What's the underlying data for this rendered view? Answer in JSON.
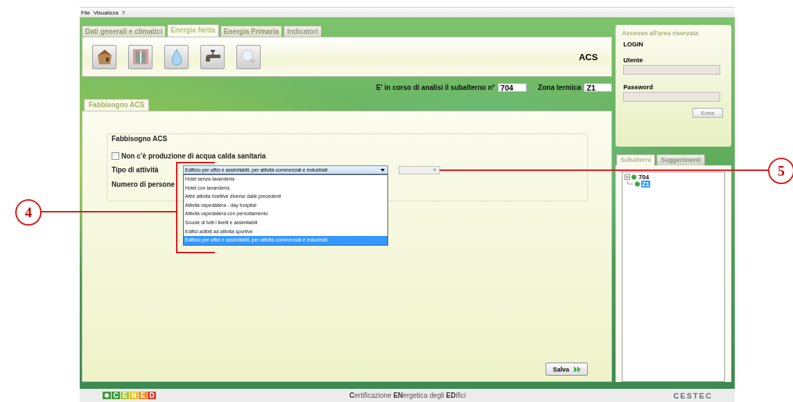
{
  "menu": [
    {
      "label": "File"
    },
    {
      "label": "Visualizza"
    },
    {
      "label": "?"
    }
  ],
  "tabs": [
    {
      "label": "Dati generali e climatici",
      "selected": false,
      "disabled": false
    },
    {
      "label": "Energia Netta",
      "selected": true,
      "disabled": false
    },
    {
      "label": "Energia Primaria",
      "selected": false,
      "disabled": false
    },
    {
      "label": "Indicatori",
      "selected": false,
      "disabled": true
    }
  ],
  "toolbar": {
    "tools": [
      {
        "kind": "building"
      },
      {
        "kind": "window"
      },
      {
        "kind": "drop"
      },
      {
        "kind": "tap"
      },
      {
        "kind": "bulb"
      }
    ],
    "section_title": "ACS"
  },
  "status": {
    "subalterno_label": "E' in corso di analisi il subalterno n°",
    "subalterno": "704",
    "zona_label": "Zona termica",
    "zona": "Z1"
  },
  "subtabs": [
    {
      "label": "Fabbisogno ACS",
      "selected": true
    }
  ],
  "group": {
    "title": "Fabbisogno ACS",
    "no_production": {
      "label": "Non c’è produzione di acqua calda sanitaria",
      "checked": false
    },
    "tipo_label": "Tipo di attività",
    "tipo_value": "Edificio per uffici e assimilabili, per attività commerciali e industriali",
    "persone_label": "Numero di persone",
    "secondary_select": {
      "disabled": true
    },
    "options": [
      {
        "label": "Hotel senza lavanderia",
        "selected": false
      },
      {
        "label": "Hotel con lavanderia",
        "selected": false
      },
      {
        "label": "Altre attività ricettive diverse dalle precedenti",
        "selected": false
      },
      {
        "label": "Attività ospedaliera - day hospital",
        "selected": false
      },
      {
        "label": "Attività ospedaliera con pernottamento",
        "selected": false
      },
      {
        "label": "Scuole di tutti i livelli e assimilabili",
        "selected": false
      },
      {
        "label": "Edifici adibiti ad attività sportive",
        "selected": false
      },
      {
        "label": "Edificio per uffici e assimilabili, per attività commerciali e industriali",
        "selected": true
      }
    ]
  },
  "save_button": "Salva",
  "login": {
    "title": "Accesso all'area riservata",
    "heading": "LOGIN",
    "user_label": "Utente",
    "password_label": "Password",
    "submit": "Entra"
  },
  "side_tabs": [
    {
      "label": "Subalterni",
      "selected": true
    },
    {
      "label": "Suggerimenti",
      "selected": false
    }
  ],
  "tree": [
    {
      "label": "704",
      "expanded": true,
      "selected": false,
      "children": [
        {
          "label": "Z1",
          "selected": true
        }
      ]
    }
  ],
  "footer": {
    "logo_letters": [
      {
        "text": "C",
        "color": "#3f9b3a"
      },
      {
        "text": "E",
        "color": "#a6c83a"
      },
      {
        "text": "N",
        "color": "#ecc21c"
      },
      {
        "text": "E",
        "color": "#f08d25"
      },
      {
        "text": "D",
        "color": "#e23a2c"
      }
    ],
    "tagline": "**C**ertificazione **EN**ergetica degli **ED**ifici",
    "brand": "CESTEC"
  },
  "callouts": [
    {
      "label": "4"
    },
    {
      "label": "5"
    }
  ]
}
